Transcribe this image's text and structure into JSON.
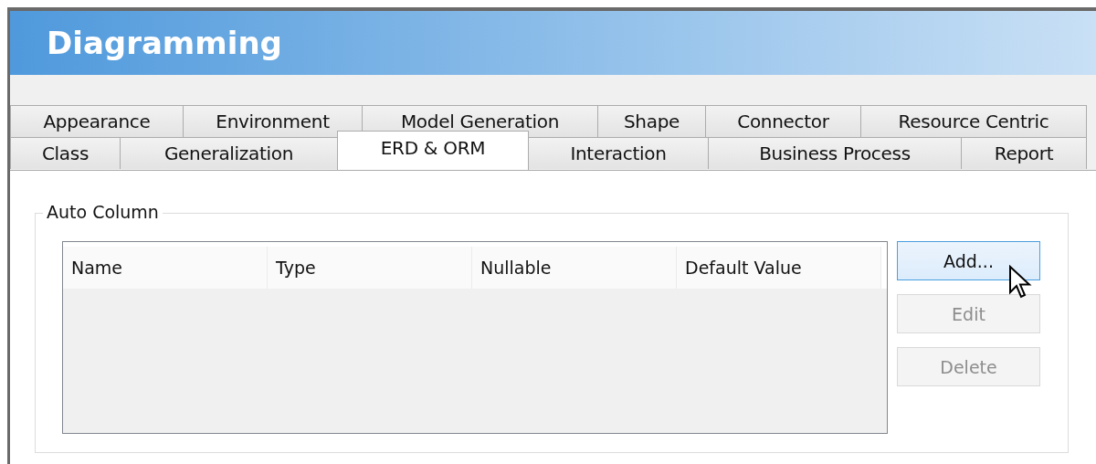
{
  "window": {
    "title": "Diagramming"
  },
  "tab_rows": [
    {
      "tabs": [
        {
          "label": "Appearance",
          "selected": false
        },
        {
          "label": "Environment",
          "selected": false
        },
        {
          "label": "Model Generation",
          "selected": false
        },
        {
          "label": "Shape",
          "selected": false
        },
        {
          "label": "Connector",
          "selected": false
        },
        {
          "label": "Resource Centric",
          "selected": false
        }
      ]
    },
    {
      "tabs": [
        {
          "label": "Class",
          "selected": false
        },
        {
          "label": "Generalization",
          "selected": false
        },
        {
          "label": "ERD & ORM",
          "selected": true
        },
        {
          "label": "Interaction",
          "selected": false
        },
        {
          "label": "Business Process",
          "selected": false
        },
        {
          "label": "Report",
          "selected": false
        }
      ]
    }
  ],
  "group": {
    "title": "Auto Column",
    "table": {
      "columns": [
        "Name",
        "Type",
        "Nullable",
        "Default Value"
      ]
    },
    "buttons": [
      {
        "label": "Add...",
        "hovered": true,
        "disabled": false
      },
      {
        "label": "Edit",
        "hovered": false,
        "disabled": true
      },
      {
        "label": "Delete",
        "hovered": false,
        "disabled": true
      }
    ]
  }
}
